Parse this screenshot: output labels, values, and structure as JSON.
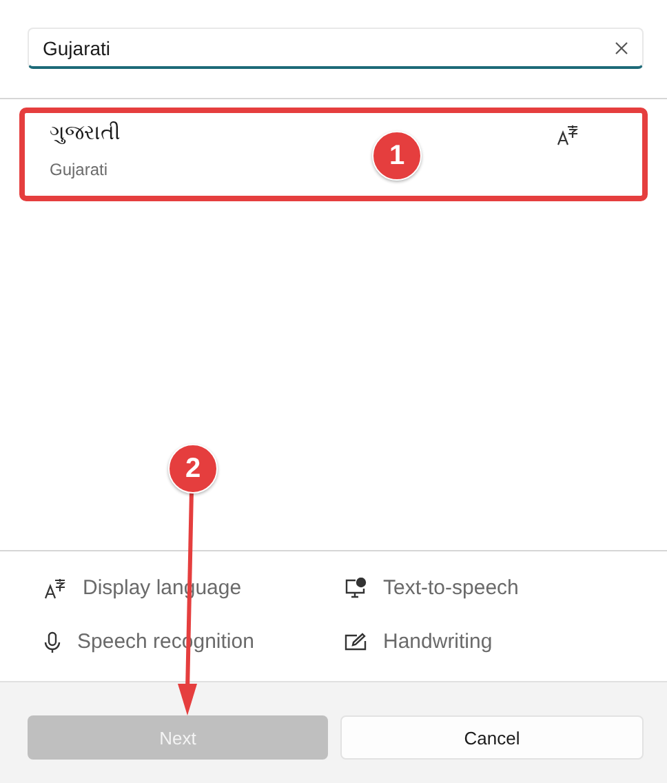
{
  "search": {
    "value": "Gujarati"
  },
  "results": [
    {
      "native": "ગુજરાતી",
      "english": "Gujarati",
      "highlighted": true
    }
  ],
  "features": [
    {
      "kind": "display",
      "label": "Display language"
    },
    {
      "kind": "tts",
      "label": "Text-to-speech"
    },
    {
      "kind": "speech",
      "label": "Speech recognition"
    },
    {
      "kind": "handwriting",
      "label": "Handwriting"
    }
  ],
  "buttons": [
    {
      "label": "Next",
      "disabled": true
    },
    {
      "label": "Cancel",
      "disabled": false
    }
  ],
  "annotations": [
    {
      "number": "1"
    },
    {
      "number": "2"
    }
  ]
}
